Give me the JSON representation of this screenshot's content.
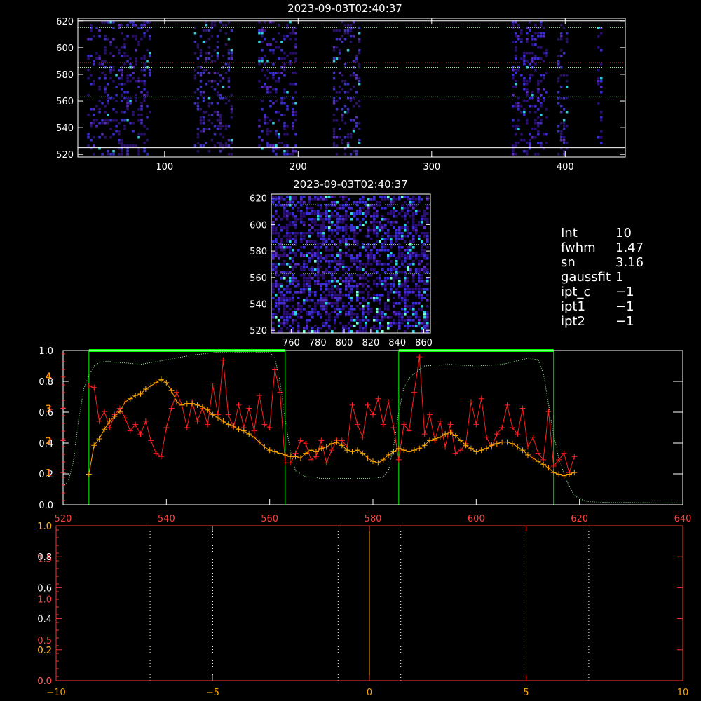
{
  "colors": {
    "background": "#000000",
    "axis": "#ffffff",
    "red_axis": "#ff3030",
    "orange": "#ffa500",
    "green": "#00ff00",
    "green_dotted": "#98f598",
    "light_yellow": "#f5f5c0",
    "heat_low": "#2b1070",
    "heat_mid": "#3a2fd0",
    "heat_high": "#30d0e0"
  },
  "params": {
    "int_label": "Int",
    "int_value": "10",
    "fwhm_label": "fwhm",
    "fwhm_value": "1.47",
    "sn_label": "sn",
    "sn_value": "3.16",
    "gaussfit_label": "gaussfit",
    "gaussfit_value": "1",
    "ipt_c_label": "ipt_c",
    "ipt_c_value": "−1",
    "ipt1_label": "ipt1",
    "ipt1_value": "−1",
    "ipt2_label": "ipt2",
    "ipt2_value": "−1"
  },
  "chart_data": [
    {
      "id": "heatmap_full",
      "type": "heatmap",
      "title": "2023-09-03T02:40:37",
      "xlim": [
        35,
        445
      ],
      "ylim": [
        518,
        622
      ],
      "xticks": [
        100,
        200,
        300,
        400
      ],
      "yticks": [
        520,
        540,
        560,
        580,
        600,
        620
      ],
      "active_x_ranges": [
        [
          42,
          90
        ],
        [
          122,
          150
        ],
        [
          170,
          198
        ],
        [
          226,
          246
        ],
        [
          360,
          386
        ],
        [
          394,
          402
        ],
        [
          424,
          428
        ]
      ],
      "hlines": [
        {
          "y": 620,
          "color": "#ffffff",
          "style": "solid"
        },
        {
          "y": 525,
          "color": "#ffffff",
          "style": "solid"
        },
        {
          "y": 615,
          "color": "#98f598",
          "style": "dotted"
        },
        {
          "y": 589,
          "color": "#ff6060",
          "style": "dotted"
        },
        {
          "y": 585,
          "color": "#98f598",
          "style": "dotted"
        },
        {
          "y": 563,
          "color": "#98f598",
          "style": "dotted"
        }
      ]
    },
    {
      "id": "heatmap_zoom",
      "type": "heatmap",
      "title": "2023-09-03T02:40:37",
      "xlim": [
        745,
        865
      ],
      "ylim": [
        518,
        623
      ],
      "xticks": [
        760,
        780,
        800,
        820,
        840,
        860
      ],
      "yticks": [
        520,
        540,
        560,
        580,
        600,
        620
      ],
      "hlines": [
        {
          "y": 615,
          "color": "#98f598",
          "style": "dotted"
        },
        {
          "y": 585,
          "color": "#98f598",
          "style": "dotted"
        },
        {
          "y": 563,
          "color": "#98f598",
          "style": "dotted"
        }
      ]
    },
    {
      "id": "profile",
      "type": "line",
      "xlim": [
        520,
        640
      ],
      "xticks": [
        520,
        540,
        560,
        580,
        600,
        620,
        640
      ],
      "left_ticks_white": [
        0.0,
        0.2,
        0.4,
        0.6,
        0.8,
        1.0
      ],
      "left_ticks_red": [
        1,
        2,
        3,
        4
      ],
      "left_ticks_orange": [
        1,
        2,
        3,
        4
      ],
      "ylim_white": [
        0,
        1.0
      ],
      "ylim_data": [
        0,
        4.8
      ],
      "green_regions": [
        [
          525,
          563
        ],
        [
          585,
          615
        ]
      ],
      "series": [
        {
          "color": "#ff2020",
          "marker": "plus",
          "x": [
            525,
            526,
            527,
            528,
            529,
            530,
            531,
            532,
            533,
            534,
            535,
            536,
            537,
            538,
            539,
            540,
            541,
            542,
            543,
            544,
            545,
            546,
            547,
            548,
            549,
            550,
            551,
            552,
            553,
            554,
            555,
            556,
            557,
            558,
            559,
            560,
            561,
            562,
            563,
            564,
            565,
            566,
            567,
            568,
            569,
            570,
            571,
            572,
            573,
            574,
            575,
            576,
            577,
            578,
            579,
            580,
            581,
            582,
            583,
            584,
            585,
            586,
            587,
            588,
            589,
            590,
            591,
            592,
            593,
            594,
            595,
            596,
            597,
            598,
            599,
            600,
            601,
            602,
            603,
            604,
            605,
            606,
            607,
            608,
            609,
            610,
            611,
            612,
            613,
            614,
            615,
            616,
            617,
            618,
            619
          ],
          "values": [
            3.7,
            3.65,
            2.6,
            2.9,
            2.4,
            2.8,
            3.0,
            2.7,
            2.3,
            2.5,
            2.2,
            2.6,
            2.0,
            1.6,
            1.5,
            2.4,
            3.0,
            3.5,
            3.1,
            2.4,
            3.2,
            2.6,
            3.0,
            2.5,
            3.7,
            2.8,
            4.5,
            2.8,
            2.4,
            3.1,
            2.4,
            3.0,
            2.3,
            3.4,
            2.5,
            2.4,
            4.2,
            3.5,
            1.3,
            1.3,
            1.6,
            2.0,
            1.9,
            1.4,
            1.5,
            2.0,
            1.3,
            1.7,
            2.0,
            2.0,
            1.8,
            3.1,
            2.5,
            2.1,
            3.1,
            2.8,
            3.3,
            2.5,
            3.2,
            2.4,
            1.4,
            2.5,
            2.3,
            3.5,
            4.6,
            2.2,
            2.8,
            2.0,
            2.6,
            1.8,
            2.5,
            1.6,
            1.7,
            1.9,
            3.2,
            2.5,
            3.3,
            2.1,
            1.8,
            2.2,
            2.4,
            3.1,
            2.4,
            2.2,
            3.0,
            1.8,
            2.1,
            1.6,
            1.4,
            2.9,
            1.2,
            1.4,
            1.6,
            1.0,
            1.5
          ]
        },
        {
          "color": "#ffa500",
          "marker": "plus",
          "x": [
            525,
            526,
            527,
            528,
            529,
            530,
            531,
            532,
            533,
            534,
            535,
            536,
            537,
            538,
            539,
            540,
            541,
            542,
            543,
            544,
            545,
            546,
            547,
            548,
            549,
            550,
            551,
            552,
            553,
            554,
            555,
            556,
            557,
            558,
            559,
            560,
            561,
            562,
            563,
            564,
            565,
            566,
            567,
            568,
            569,
            570,
            571,
            572,
            573,
            574,
            575,
            576,
            577,
            578,
            579,
            580,
            581,
            582,
            583,
            584,
            585,
            586,
            587,
            588,
            589,
            590,
            591,
            592,
            593,
            594,
            595,
            596,
            597,
            598,
            599,
            600,
            601,
            602,
            603,
            604,
            605,
            606,
            607,
            608,
            609,
            610,
            611,
            612,
            613,
            614,
            615,
            616,
            617,
            618,
            619
          ],
          "values": [
            0.95,
            1.85,
            2.05,
            2.35,
            2.6,
            2.75,
            2.9,
            3.2,
            3.3,
            3.4,
            3.45,
            3.6,
            3.7,
            3.8,
            3.9,
            3.8,
            3.55,
            3.2,
            3.1,
            3.15,
            3.15,
            3.1,
            3.05,
            2.95,
            2.8,
            2.7,
            2.6,
            2.5,
            2.45,
            2.35,
            2.3,
            2.2,
            2.1,
            1.95,
            1.8,
            1.7,
            1.65,
            1.6,
            1.55,
            1.5,
            1.5,
            1.45,
            1.6,
            1.7,
            1.65,
            1.75,
            1.8,
            1.9,
            1.95,
            1.85,
            1.7,
            1.65,
            1.7,
            1.6,
            1.45,
            1.35,
            1.3,
            1.4,
            1.55,
            1.65,
            1.75,
            1.7,
            1.65,
            1.7,
            1.75,
            1.85,
            2.0,
            2.05,
            2.1,
            2.2,
            2.25,
            2.15,
            2.0,
            1.85,
            1.75,
            1.65,
            1.7,
            1.75,
            1.85,
            1.9,
            1.95,
            1.95,
            1.9,
            1.8,
            1.7,
            1.55,
            1.45,
            1.35,
            1.25,
            1.15,
            1.0,
            0.95,
            0.9,
            0.95,
            1.0
          ]
        },
        {
          "color": "#98f598",
          "style": "dotted",
          "scale": "white",
          "x": [
            520,
            521,
            522,
            523,
            524,
            525,
            526,
            527,
            528,
            529,
            530,
            532,
            535,
            540,
            545,
            550,
            555,
            560,
            561,
            562,
            563,
            564,
            565,
            566,
            567,
            568,
            570,
            575,
            580,
            582,
            583,
            584,
            585,
            586,
            587,
            588,
            590,
            595,
            600,
            605,
            610,
            612,
            613,
            614,
            615,
            616,
            617,
            618,
            619,
            620,
            621,
            622,
            625,
            630,
            635,
            640
          ],
          "values": [
            0.12,
            0.15,
            0.28,
            0.55,
            0.75,
            0.84,
            0.9,
            0.92,
            0.93,
            0.93,
            0.92,
            0.92,
            0.91,
            0.94,
            0.97,
            0.99,
            0.99,
            0.99,
            0.95,
            0.8,
            0.55,
            0.35,
            0.22,
            0.2,
            0.18,
            0.18,
            0.17,
            0.17,
            0.17,
            0.18,
            0.22,
            0.38,
            0.6,
            0.76,
            0.82,
            0.85,
            0.9,
            0.91,
            0.9,
            0.91,
            0.95,
            0.94,
            0.85,
            0.65,
            0.45,
            0.3,
            0.2,
            0.12,
            0.06,
            0.04,
            0.025,
            0.02,
            0.015,
            0.015,
            0.012,
            0.012
          ]
        }
      ]
    },
    {
      "id": "fit",
      "type": "line",
      "xlim": [
        -10,
        10
      ],
      "xticks": [
        -10,
        -5,
        0,
        5,
        10
      ],
      "left_ticks_white": [
        0.0,
        0.2,
        0.4,
        0.6,
        0.8,
        1.0
      ],
      "left_ticks_red": [
        0.0,
        0.5,
        1.0,
        1.5
      ],
      "left_ticks_orange": [
        0.0,
        0.2
      ],
      "ylim_white": [
        0,
        1.0
      ],
      "vlines_dotted_light": [
        -7,
        -5,
        5,
        7
      ],
      "vlines_dotted_white": [
        -1,
        1
      ],
      "vline_center": 0
    }
  ]
}
